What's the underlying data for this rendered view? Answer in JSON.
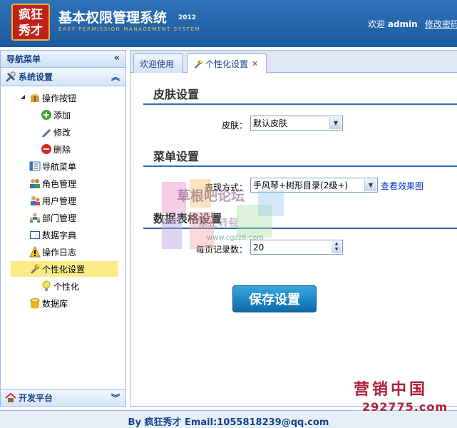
{
  "header": {
    "logo_text": "疯狂\n秀才",
    "title": "基本权限管理系统",
    "year": "2012",
    "subtitle": "EASY PERMISSION MANAGEMENT SYSTEM",
    "welcome_prefix": "欢迎",
    "username": "admin",
    "change_password": "修改密码"
  },
  "sidebar": {
    "title": "导航菜单",
    "section": "系统设置",
    "items": [
      {
        "label": "操作按钮",
        "icon": "package-icon"
      },
      {
        "label": "添加",
        "icon": "add-icon"
      },
      {
        "label": "修改",
        "icon": "pencil-icon"
      },
      {
        "label": "删除",
        "icon": "delete-icon"
      },
      {
        "label": "导航菜单",
        "icon": "menu-icon"
      },
      {
        "label": "角色管理",
        "icon": "users-icon"
      },
      {
        "label": "用户管理",
        "icon": "user-icon"
      },
      {
        "label": "部门管理",
        "icon": "department-icon"
      },
      {
        "label": "数据字典",
        "icon": "book-icon"
      },
      {
        "label": "操作日志",
        "icon": "warning-icon"
      },
      {
        "label": "个性化设置",
        "icon": "wrench-icon"
      },
      {
        "label": "个性化",
        "icon": "lightbulb-icon"
      },
      {
        "label": "数据库",
        "icon": "database-icon"
      }
    ],
    "bottom_section": "开发平台"
  },
  "tabs": [
    {
      "label": "欢迎使用"
    },
    {
      "label": "个性化设置"
    }
  ],
  "skin": {
    "title": "皮肤设置",
    "label": "皮肤：",
    "value": "默认皮肤"
  },
  "menu": {
    "title": "菜单设置",
    "label": "表现方式：",
    "value": "手风琴+树形目录(2级+)",
    "preview_link": "查看效果图"
  },
  "grid": {
    "title": "数据表格设置",
    "label": "每页记录数：",
    "value": "20"
  },
  "save_button": "保存设置",
  "watermark": {
    "line1": "草根吧论坛",
    "line2": "禁止转载",
    "line3": "www.cgzz8.com"
  },
  "footer": {
    "text": "By 疯狂秀才 Email:1055818239@qq.com"
  },
  "badge": {
    "line1": "营销中国",
    "line2": "292775.com"
  },
  "colors": {
    "header_blue": "#1b5a9f",
    "accent": "#2b6cb0",
    "selected": "#fbec88",
    "badge": "#b0203a"
  }
}
